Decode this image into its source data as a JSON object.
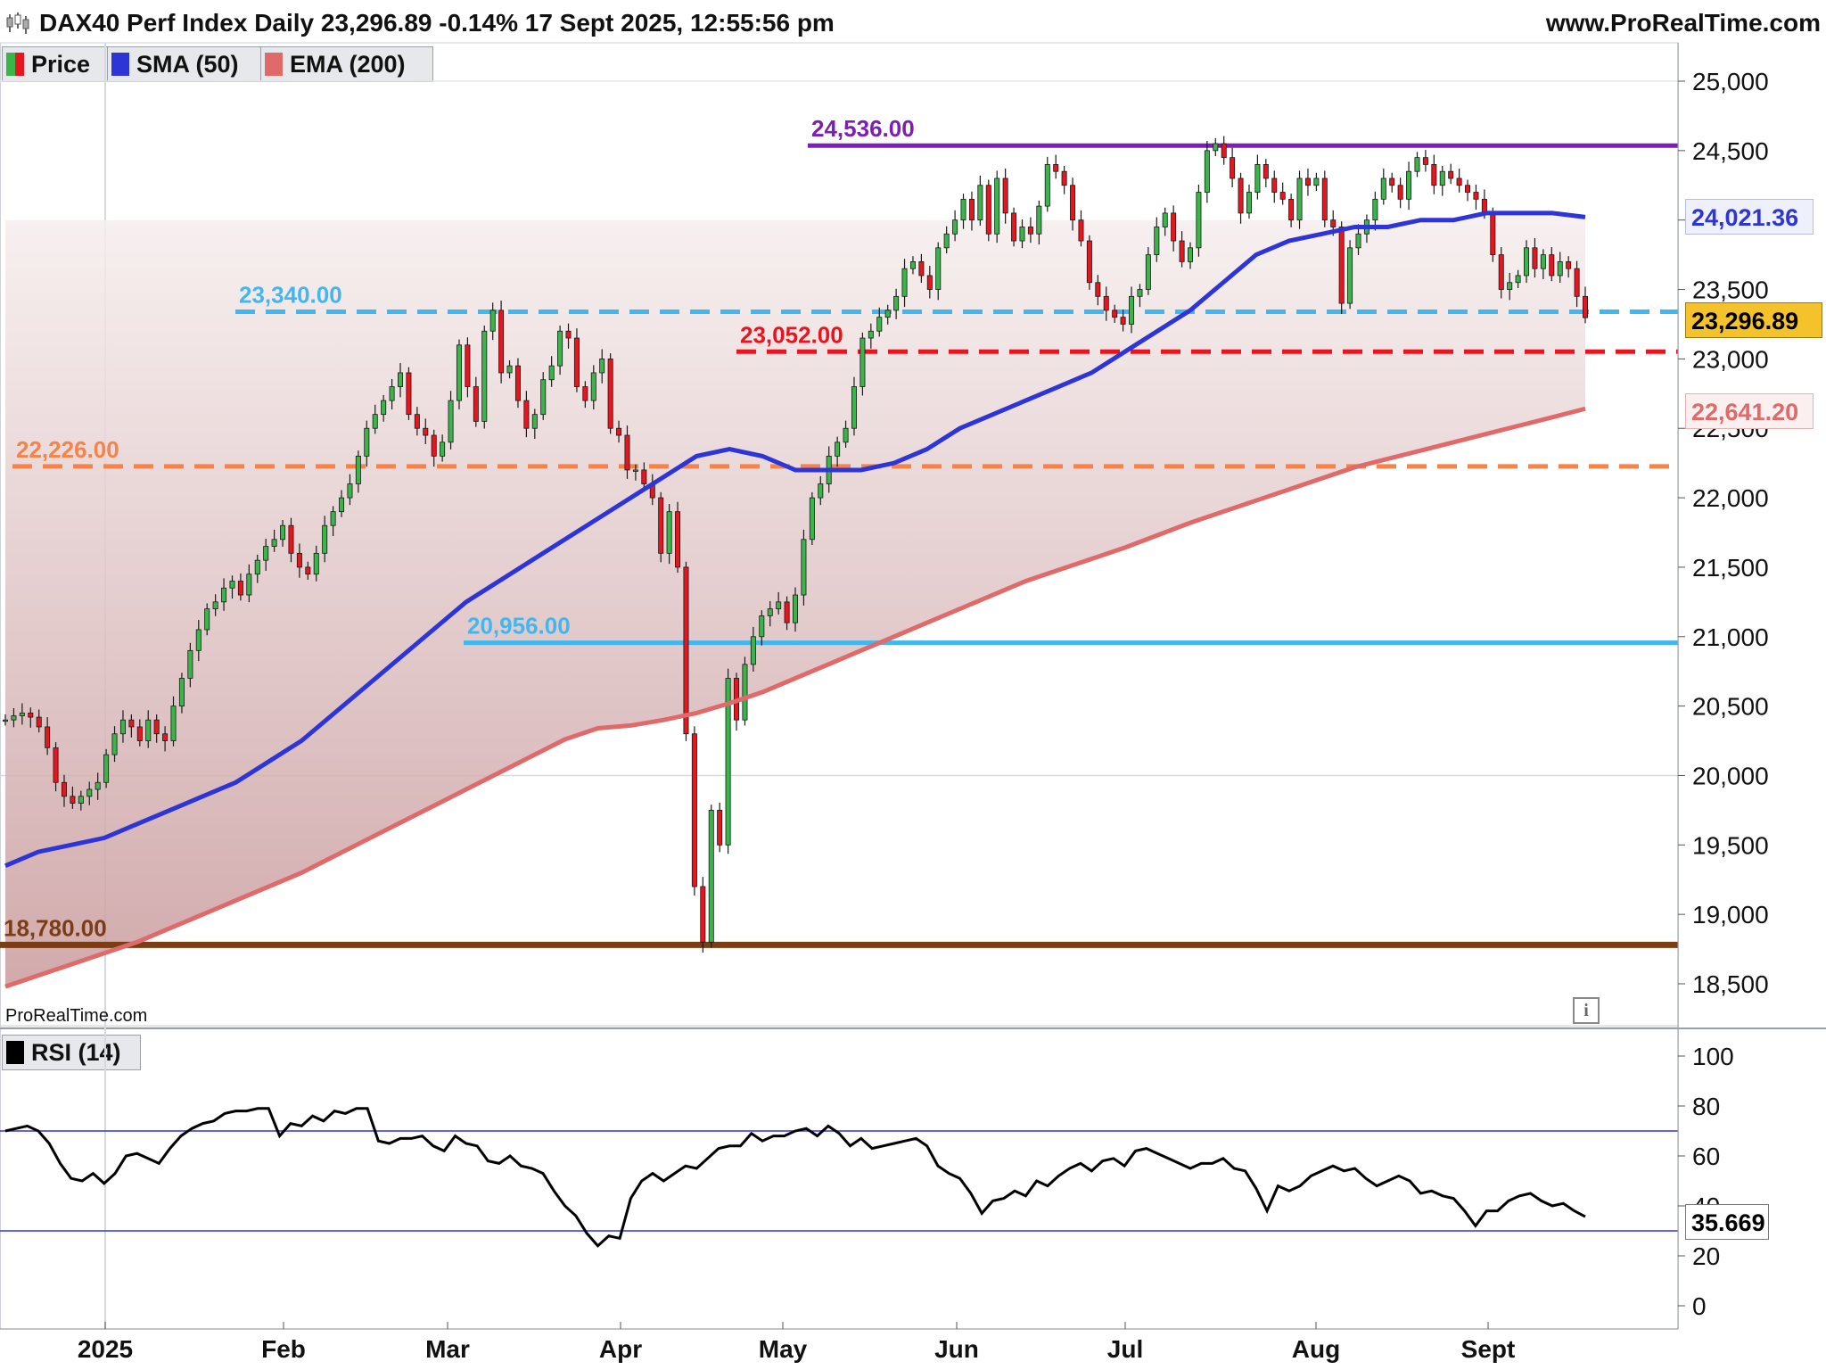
{
  "header": {
    "title": "DAX40 Perf Index Daily 23,296.89 -0.14% 17 Sept 2025, 12:55:56 pm",
    "site": "www.ProRealTime.com"
  },
  "legend": [
    {
      "label": "Price",
      "color": "#39b54a"
    },
    {
      "label": "SMA (50)",
      "color": "#2e35d6"
    },
    {
      "label": "EMA (200)",
      "color": "#e06a6a"
    }
  ],
  "rsi_legend": {
    "label": "RSI (14)",
    "color": "#000000"
  },
  "credit": "ProRealTime.com",
  "labels": {
    "sma_last": "24,021.36",
    "price_last": "23,296.89",
    "ema_last": "22,641.20",
    "rsi_last": "35.669"
  },
  "chart_data": [
    {
      "type": "candlestick",
      "title": "DAX40 Perf Index Daily",
      "x_ticks": [
        "2025",
        "Feb",
        "Mar",
        "Apr",
        "May",
        "Jun",
        "Jul",
        "Aug",
        "Sept"
      ],
      "ylim": [
        18400,
        25150
      ],
      "y_ticks": [
        18500,
        19000,
        19500,
        20000,
        20500,
        21000,
        21500,
        22000,
        22500,
        23000,
        23500,
        24000,
        24500,
        25000
      ],
      "y_tick_labels": [
        "18,500",
        "19,000",
        "19,500",
        "20,000",
        "20,500",
        "21,000",
        "21,500",
        "22,000",
        "22,500",
        "23,000",
        "23,500",
        "24,000",
        "24,500",
        "25,000"
      ],
      "horizontal_levels": [
        {
          "value": 24536.0,
          "label": "24,536.00",
          "color": "#7d1fb4",
          "style": "solid"
        },
        {
          "value": 23340.0,
          "label": "23,340.00",
          "color": "#3fb8f2",
          "style": "dashed"
        },
        {
          "value": 23052.0,
          "label": "23,052.00",
          "color": "#e8141e",
          "style": "dashed"
        },
        {
          "value": 22226.0,
          "label": "22,226.00",
          "color": "#f5834a",
          "style": "dashed"
        },
        {
          "value": 20956.0,
          "label": "20,956.00",
          "color": "#3fb8f2",
          "style": "solid"
        },
        {
          "value": 18780.0,
          "label": "18,780.00",
          "color": "#7a3d14",
          "style": "solid"
        }
      ],
      "series": [
        {
          "name": "Price",
          "values": [
            20400,
            20430,
            20450,
            20420,
            20350,
            20200,
            19950,
            19850,
            19800,
            19850,
            19900,
            19950,
            20150,
            20300,
            20400,
            20350,
            20250,
            20400,
            20300,
            20250,
            20500,
            20700,
            20900,
            21050,
            21200,
            21250,
            21350,
            21400,
            21300,
            21450,
            21550,
            21650,
            21700,
            21800,
            21600,
            21500,
            21450,
            21600,
            21800,
            21900,
            22000,
            22100,
            22300,
            22500,
            22600,
            22700,
            22800,
            22900,
            22600,
            22500,
            22450,
            22300,
            22400,
            22700,
            23100,
            22800,
            22550,
            23200,
            23350,
            22900,
            22950,
            22700,
            22500,
            22600,
            22850,
            22950,
            23200,
            23150,
            22800,
            22700,
            22900,
            23000,
            22500,
            22450,
            22200,
            22200,
            22100,
            22000,
            21600,
            21900,
            21500,
            20300,
            19200,
            18800,
            19750,
            19500,
            20700,
            20400,
            20800,
            21000,
            21150,
            21200,
            21250,
            21100,
            21300,
            21700,
            22000,
            22100,
            22300,
            22400,
            22500,
            22800,
            23150,
            23200,
            23300,
            23350,
            23450,
            23650,
            23700,
            23600,
            23500,
            23800,
            23900,
            24000,
            24150,
            24000,
            24250,
            23900,
            24300,
            24050,
            23850,
            23950,
            23900,
            24100,
            24400,
            24350,
            24250,
            24000,
            23850,
            23550,
            23450,
            23350,
            23300,
            23250,
            23450,
            23500,
            23750,
            23950,
            24050,
            23850,
            23700,
            23800,
            24200,
            24500,
            24550,
            24450,
            24300,
            24050,
            24200,
            24400,
            24300,
            24200,
            24150,
            24000,
            24300,
            24250,
            24300,
            24000,
            23950,
            23400,
            23800,
            23900,
            24000,
            24150,
            24300,
            24250,
            24150,
            24350,
            24450,
            24400,
            24250,
            24350,
            24300,
            24250,
            24200,
            24150,
            24050,
            23750,
            23500,
            23550,
            23600,
            23800,
            23650,
            23750,
            23600,
            23700,
            23650,
            23450,
            23296.89
          ]
        },
        {
          "name": "SMA (50)",
          "values": [
            19350,
            19450,
            19500,
            19550,
            19650,
            19750,
            19850,
            19950,
            20100,
            20250,
            20450,
            20650,
            20850,
            21050,
            21250,
            21400,
            21550,
            21700,
            21850,
            22000,
            22150,
            22300,
            22350,
            22300,
            22200,
            22200,
            22200,
            22250,
            22350,
            22500,
            22600,
            22700,
            22800,
            22900,
            23050,
            23200,
            23350,
            23550,
            23750,
            23850,
            23900,
            23950,
            23950,
            24000,
            24000,
            24050,
            24050,
            24050,
            24021.36
          ],
          "color": "#2e35d6"
        },
        {
          "name": "EMA (200)",
          "values": [
            18480,
            18560,
            18640,
            18720,
            18800,
            18900,
            19000,
            19100,
            19200,
            19300,
            19420,
            19540,
            19660,
            19780,
            19900,
            20020,
            20140,
            20260,
            20340,
            20360,
            20400,
            20450,
            20520,
            20600,
            20700,
            20800,
            20900,
            21000,
            21100,
            21200,
            21300,
            21400,
            21480,
            21560,
            21640,
            21730,
            21820,
            21900,
            21980,
            22060,
            22140,
            22220,
            22280,
            22340,
            22400,
            22460,
            22520,
            22580,
            22641.2
          ],
          "color": "#e06a6a"
        }
      ]
    },
    {
      "type": "line",
      "title": "RSI (14)",
      "ylim": [
        -5,
        105
      ],
      "y_ticks": [
        0,
        20,
        40,
        60,
        80,
        100
      ],
      "overbought": 70,
      "oversold": 30,
      "series": [
        {
          "name": "RSI (14)",
          "values": [
            70,
            71,
            72,
            70,
            65,
            57,
            51,
            50,
            53,
            49,
            53,
            60,
            61,
            59,
            57,
            63,
            68,
            71,
            73,
            74,
            77,
            78,
            78,
            79,
            79,
            68,
            73,
            72,
            76,
            74,
            78,
            77,
            79,
            79,
            66,
            65,
            67,
            67,
            68,
            64,
            62,
            68,
            65,
            64,
            58,
            57,
            60,
            56,
            55,
            53,
            46,
            40,
            36,
            29,
            24,
            28,
            27,
            43,
            50,
            53,
            50,
            53,
            56,
            55,
            59,
            63,
            64,
            64,
            69,
            66,
            68,
            68,
            70,
            71,
            68,
            72,
            69,
            64,
            67,
            63,
            64,
            65,
            66,
            67,
            64,
            56,
            53,
            51,
            45,
            37,
            42,
            43,
            46,
            44,
            50,
            48,
            52,
            55,
            57,
            54,
            58,
            59,
            56,
            62,
            63,
            61,
            59,
            57,
            55,
            57,
            57,
            59,
            55,
            54,
            47,
            38,
            48,
            46,
            48,
            52,
            54,
            56,
            54,
            55,
            51,
            48,
            50,
            52,
            50,
            45,
            46,
            44,
            43,
            38,
            32,
            38,
            38,
            42,
            44,
            45,
            42,
            40,
            41,
            38,
            35.669
          ],
          "color": "#000000"
        }
      ]
    }
  ]
}
